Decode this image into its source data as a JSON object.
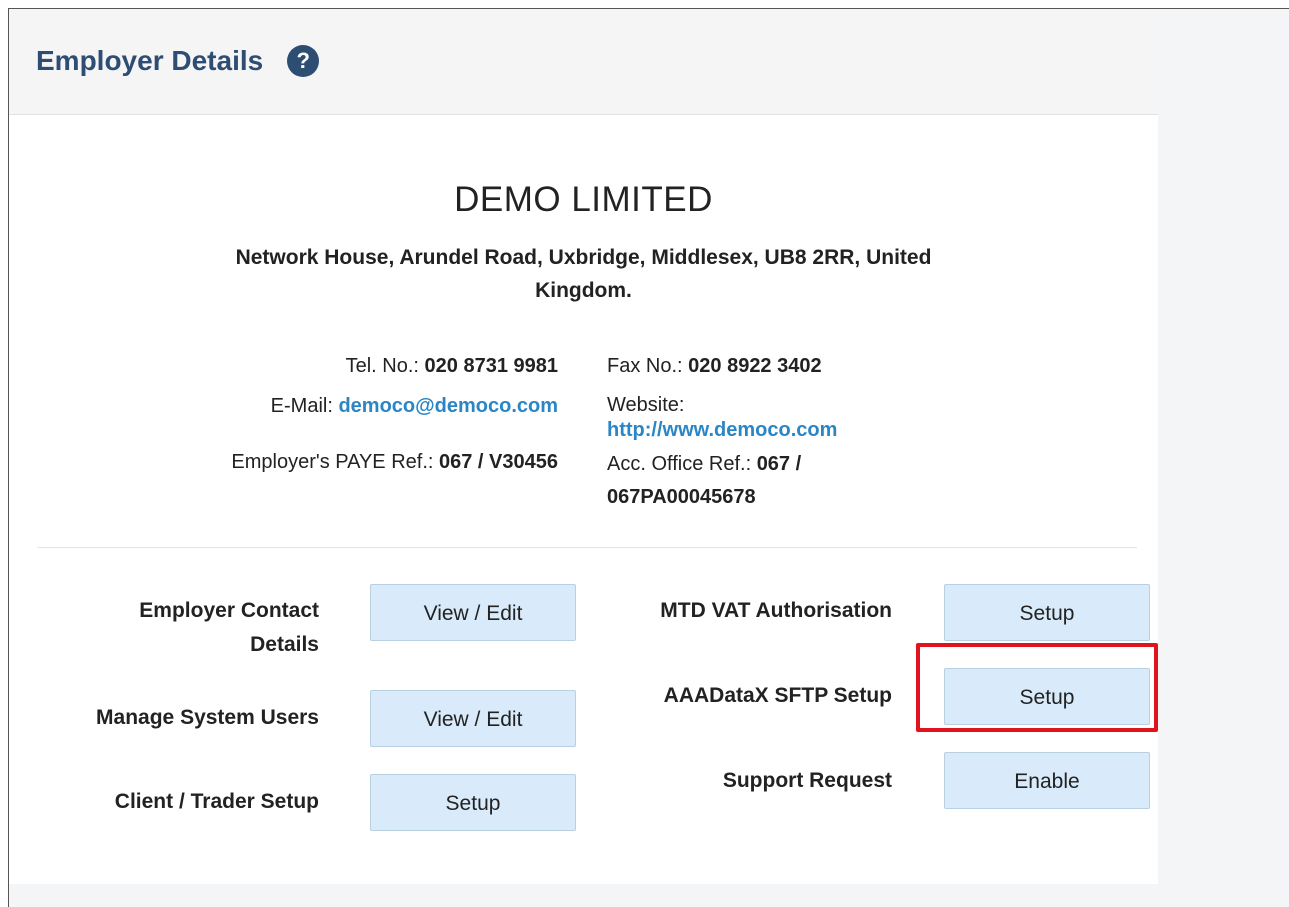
{
  "header": {
    "title": "Employer Details",
    "help_icon": "?"
  },
  "company": {
    "name": "DEMO LIMITED",
    "address_line1": "Network House, Arundel Road, Uxbridge, Middlesex, UB8 2RR, United",
    "address_line2": "Kingdom."
  },
  "contact": {
    "tel_label": "Tel. No.: ",
    "tel_value": "020 8731 9981",
    "fax_label": "Fax No.: ",
    "fax_value": "020 8922 3402",
    "email_label": "E-Mail: ",
    "email_value": "democo@democo.com",
    "website_label": "Website:",
    "website_value": "http://www.democo.com",
    "paye_label": "Employer's PAYE Ref.: ",
    "paye_value": "067 / V30456",
    "acc_office_label": "Acc. Office Ref.: ",
    "acc_office_value_line1": "067 /",
    "acc_office_value_line2": "067PA00045678"
  },
  "actions": {
    "employer_contact_label_line1": "Employer Contact",
    "employer_contact_label_line2": "Details",
    "employer_contact_button": "View / Edit",
    "manage_users_label": "Manage System Users",
    "manage_users_button": "View / Edit",
    "client_trader_label": "Client / Trader Setup",
    "client_trader_button": "Setup",
    "mtd_vat_label": "MTD VAT Authorisation",
    "mtd_vat_button": "Setup",
    "aaadatax_label": "AAADataX SFTP Setup",
    "aaadatax_button": "Setup",
    "support_label": "Support Request",
    "support_button": "Enable"
  },
  "colors": {
    "title": "#2d4d73",
    "link": "#2a86c5",
    "button_bg": "#d9ebfa",
    "highlight": "#e0141e"
  }
}
